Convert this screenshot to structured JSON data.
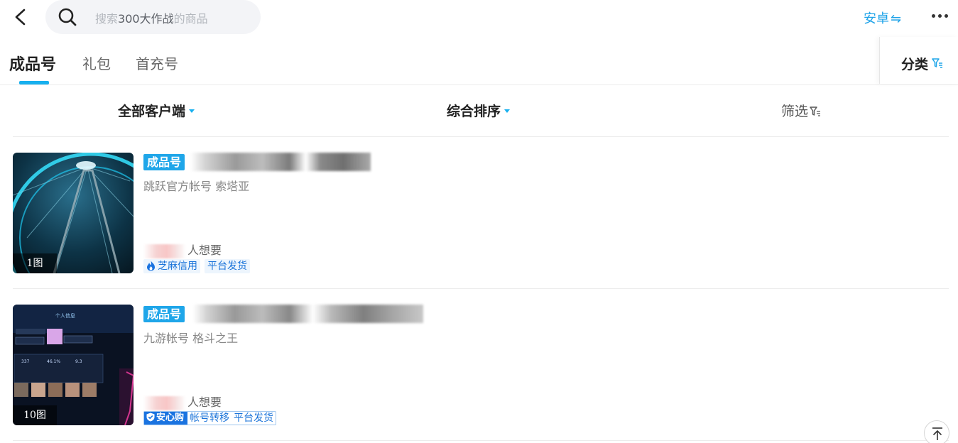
{
  "search": {
    "placeholder_prefix": "搜索",
    "keyword": "300大作战",
    "placeholder_suffix": "的商品"
  },
  "header": {
    "platform": "安卓",
    "platform_switch_icon": "swap-arrows-icon",
    "more_icon": "more-dots-icon"
  },
  "tabs": [
    {
      "label": "成品号",
      "active": true
    },
    {
      "label": "礼包",
      "active": false
    },
    {
      "label": "首充号",
      "active": false
    }
  ],
  "category_label": "分类",
  "filters": {
    "client": "全部客户端",
    "sort": "综合排序",
    "screen": "筛选"
  },
  "colors": {
    "accent": "#1fa6e9",
    "badge_text": "#1a73d9",
    "badge_bg": "#edf5fd"
  },
  "items": [
    {
      "tag": "成品号",
      "subtitle": "跳跃官方帐号 索塔亚",
      "wants_suffix": "人想要",
      "image_count": "1图",
      "badges": [
        "芝麻信用",
        "平台发货"
      ]
    },
    {
      "tag": "成品号",
      "subtitle": "九游帐号 格斗之王",
      "wants_suffix": "人想要",
      "image_count": "10图",
      "guarantee": "安心购",
      "badges": [
        "帐号转移",
        "平台发货"
      ]
    }
  ]
}
